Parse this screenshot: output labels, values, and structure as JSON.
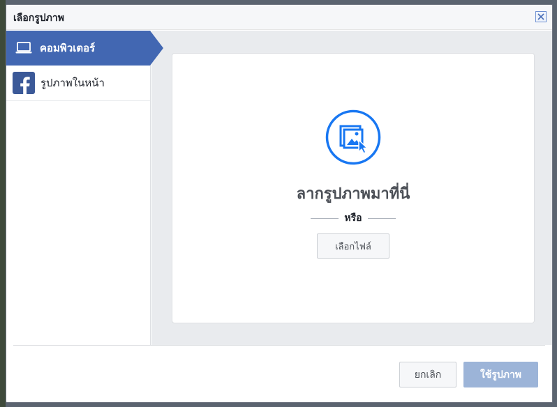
{
  "dialog": {
    "title": "เลือกรูปภาพ",
    "close_icon": "close-icon"
  },
  "sidebar": {
    "items": [
      {
        "label": "คอมพิวเตอร์",
        "icon": "laptop-icon",
        "active": true
      },
      {
        "label": "รูปภาพในหน้า",
        "icon": "facebook-icon",
        "active": false
      }
    ]
  },
  "dropzone": {
    "icon": "image-upload-icon",
    "title": "ลากรูปภาพมาที่นี่",
    "or_text": "หรือ",
    "choose_file_label": "เลือกไฟล์"
  },
  "footer": {
    "cancel_label": "ยกเลิก",
    "use_photo_label": "ใช้รูปภาพ"
  },
  "colors": {
    "accent": "#4267b2",
    "icon_blue": "#1877f2",
    "disabled_button": "#9cb4d8"
  }
}
